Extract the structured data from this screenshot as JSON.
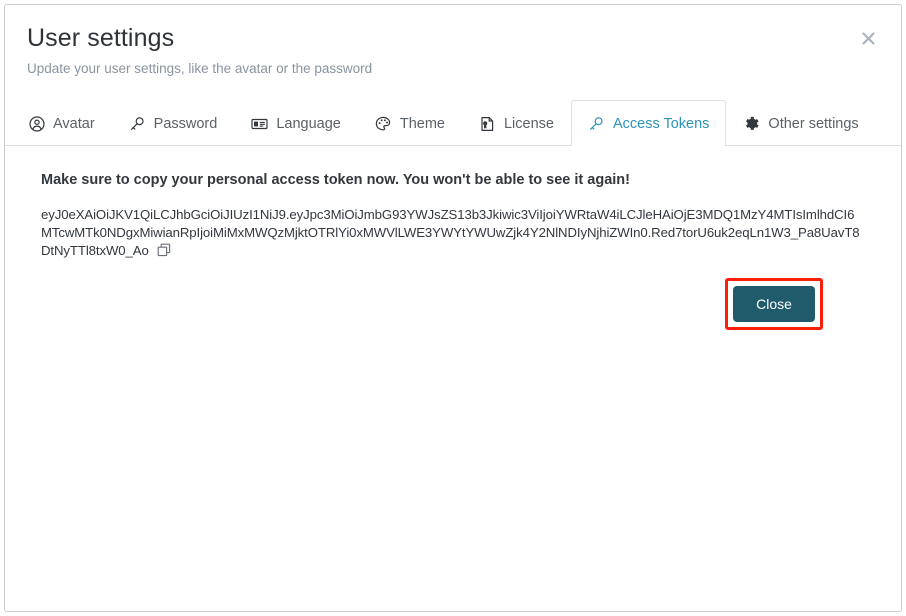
{
  "dialog": {
    "title": "User settings",
    "subtitle": "Update your user settings, like the avatar or the password",
    "close_icon": "close-x-icon"
  },
  "tabs": [
    {
      "label": "Avatar",
      "icon": "avatar-icon",
      "active": false
    },
    {
      "label": "Password",
      "icon": "key-icon",
      "active": false
    },
    {
      "label": "Language",
      "icon": "id-card-icon",
      "active": false
    },
    {
      "label": "Theme",
      "icon": "palette-icon",
      "active": false
    },
    {
      "label": "License",
      "icon": "license-badge-icon",
      "active": false
    },
    {
      "label": "Access Tokens",
      "icon": "key-icon",
      "active": true
    },
    {
      "label": "Other settings",
      "icon": "gear-icon",
      "active": false
    }
  ],
  "panel": {
    "warning": "Make sure to copy your personal access token now. You won't be able to see it again!",
    "token": "eyJ0eXAiOiJKV1QiLCJhbGciOiJIUzI1NiJ9.eyJpc3MiOiJmbG93YWJsZS13b3Jkiwic3ViIjoiYWRtaW4iLCJleHAiOjE3MDQ1MzY4MTIsImlhdCI6MTcwMTk0NDgxMiwianRpIjoiMiMxMWQzMjktOTRlYi0xMWVlLWE3YWYtYWUwZjk4Y2NlNDIyNjhiZWIn0.Red7torU6uk2eqLn1W3_Pa8UavT8DtNyTTl8txW0_Ao",
    "copy_icon": "copy-icon"
  },
  "footer": {
    "close_label": "Close",
    "highlight_color": "#fb1e08",
    "button_color": "#1f5b6b"
  },
  "colors": {
    "active_tab": "#2b93b8",
    "title": "#2e3338",
    "subtitle": "#8a94a0"
  }
}
